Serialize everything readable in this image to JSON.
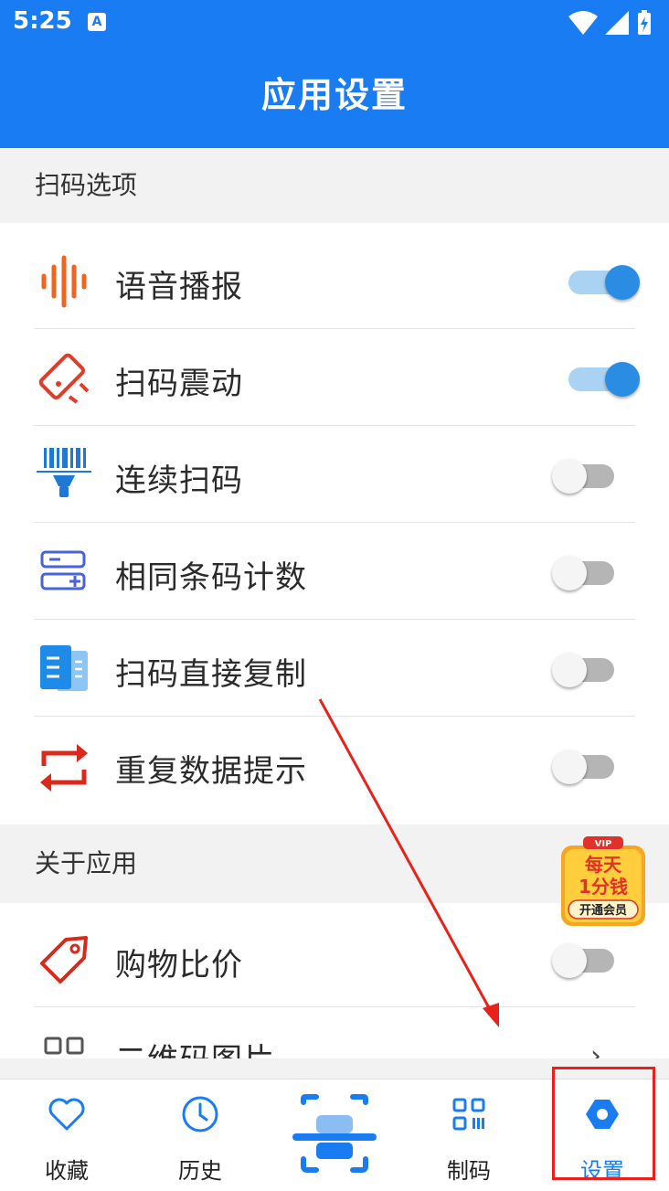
{
  "status_bar": {
    "time": "5:25",
    "notification_icon": "a-letter-icon"
  },
  "header": {
    "title": "应用设置"
  },
  "sections": {
    "scan_options": "扫码选项",
    "about_app": "关于应用"
  },
  "settings": [
    {
      "label": "语音播报",
      "icon": "voice-broadcast-icon",
      "enabled": true
    },
    {
      "label": "扫码震动",
      "icon": "vibrate-phone-icon",
      "enabled": true
    },
    {
      "label": "连续扫码",
      "icon": "continuous-scan-icon",
      "enabled": false
    },
    {
      "label": "相同条码计数",
      "icon": "count-plus-minus-icon",
      "enabled": false
    },
    {
      "label": "扫码直接复制",
      "icon": "copy-document-icon",
      "enabled": false
    },
    {
      "label": "重复数据提示",
      "icon": "repeat-arrows-icon",
      "enabled": false
    }
  ],
  "about": [
    {
      "label": "购物比价",
      "icon": "price-tag-icon",
      "enabled": false
    },
    {
      "label": "二维码图片",
      "icon": "qr-image-icon",
      "type": "link"
    }
  ],
  "vip_badge": {
    "tag": "VIP",
    "line1": "每天",
    "line2": "1分钱",
    "cta": "开通会员"
  },
  "bottom_nav": [
    {
      "label": "收藏",
      "icon": "heart-icon",
      "active": false
    },
    {
      "label": "历史",
      "icon": "clock-icon",
      "active": false
    },
    {
      "label": "制码",
      "icon": "qr-code-icon",
      "active": false
    },
    {
      "label": "设置",
      "icon": "hexagon-settings-icon",
      "active": true
    }
  ],
  "colors": {
    "primary": "#1a7cf2",
    "toggle_on": "#2a8de3",
    "annotation_red": "#e8211b",
    "section_bg": "#f2f2f2"
  }
}
